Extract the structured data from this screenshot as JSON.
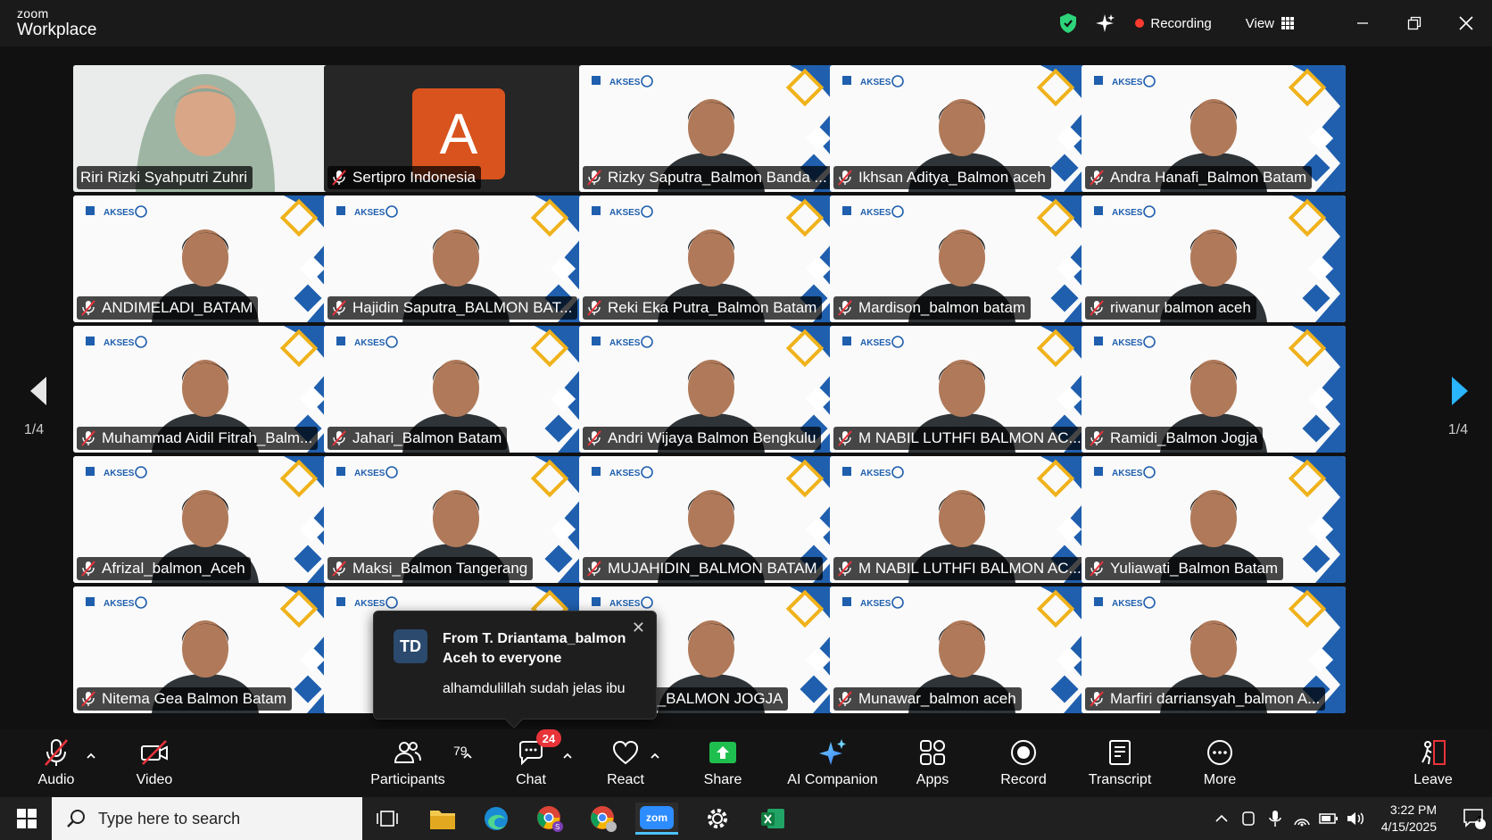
{
  "app": {
    "brand_top": "zoom",
    "brand_bottom": "Workplace"
  },
  "header": {
    "recording_label": "Recording",
    "view_label": "View"
  },
  "pager": {
    "left_label": "1/4",
    "right_label": "1/4"
  },
  "participants": [
    {
      "name": "Riri Rizki Syahputri Zuhri",
      "muted": false,
      "speaking": true,
      "avatar": ""
    },
    {
      "name": "Sertipro Indonesia",
      "muted": true,
      "avatar": "A"
    },
    {
      "name": "Rizky Saputra_Balmon Banda ...",
      "muted": true
    },
    {
      "name": "Ikhsan Aditya_Balmon aceh",
      "muted": true
    },
    {
      "name": "Andra Hanafi_Balmon Batam",
      "muted": true
    },
    {
      "name": "ANDIMELADI_BATAM",
      "muted": true
    },
    {
      "name": "Hajidin Saputra_BALMON BAT...",
      "muted": true
    },
    {
      "name": "Reki Eka Putra_Balmon Batam",
      "muted": true
    },
    {
      "name": "Mardison_balmon batam",
      "muted": true
    },
    {
      "name": "riwanur balmon aceh",
      "muted": true
    },
    {
      "name": "Muhammad Aidil Fitrah_Balm...",
      "muted": true
    },
    {
      "name": "Jahari_Balmon Batam",
      "muted": true
    },
    {
      "name": "Andri Wijaya Balmon Bengkulu",
      "muted": true
    },
    {
      "name": "M NABIL LUTHFI BALMON AC...",
      "muted": true
    },
    {
      "name": "Ramidi_Balmon Jogja",
      "muted": true
    },
    {
      "name": "Afrizal_balmon_Aceh",
      "muted": true
    },
    {
      "name": "Maksi_Balmon Tangerang",
      "muted": true
    },
    {
      "name": "MUJAHIDIN_BALMON BATAM",
      "muted": true
    },
    {
      "name": "M NABIL LUTHFI BALMON AC...",
      "muted": true
    },
    {
      "name": "Yuliawati_Balmon Batam",
      "muted": true
    },
    {
      "name": "Nitema Gea Balmon Batam",
      "muted": true
    },
    {
      "name": "",
      "muted": false
    },
    {
      "name": "WAHYUDI_BALMON JOGJA",
      "muted": false
    },
    {
      "name": "Munawar_balmon aceh",
      "muted": true
    },
    {
      "name": "Marfiri darriansyah_balmon A...",
      "muted": true
    }
  ],
  "tile_logo_text": "AKSES",
  "chat_toast": {
    "initials": "TD",
    "from": "From T. Driantama_balmon Aceh to everyone",
    "message": "alhamdulillah sudah jelas ibu"
  },
  "toolbar": {
    "audio": "Audio",
    "video": "Video",
    "participants": "Participants",
    "participants_count": "79",
    "chat": "Chat",
    "chat_badge": "24",
    "react": "React",
    "share": "Share",
    "ai_companion": "AI Companion",
    "apps": "Apps",
    "record": "Record",
    "transcript": "Transcript",
    "more": "More",
    "leave": "Leave"
  },
  "taskbar": {
    "search_placeholder": "Type here to search",
    "time": "3:22 PM",
    "date": "4/15/2025",
    "notification_count": "4",
    "apps": [
      "task-view",
      "file-explorer",
      "edge",
      "chrome-profile-s",
      "chrome",
      "zoom",
      "settings",
      "excel"
    ],
    "zoom_label": "zom"
  },
  "colors": {
    "speaking_border": "#2ed47a",
    "recording_dot": "#ff3b30",
    "share_green": "#1fbf4f",
    "badge_red": "#e8333a",
    "avatar_orange": "#d9531e",
    "tile_blue": "#1f5fae",
    "tile_yellow": "#f0b21b"
  }
}
